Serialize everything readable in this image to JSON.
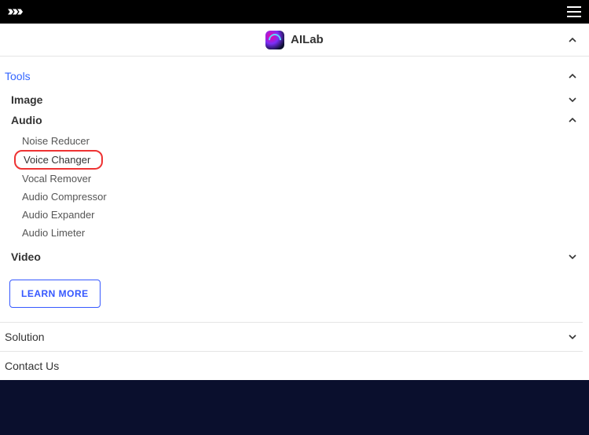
{
  "header": {
    "app_title": "AILab"
  },
  "nav": {
    "tools_label": "Tools",
    "groups": {
      "image": {
        "label": "Image"
      },
      "audio": {
        "label": "Audio",
        "items": [
          "Noise Reducer",
          "Voice Changer",
          "Vocal Remover",
          "Audio Compressor",
          "Audio Expander",
          "Audio Limeter"
        ],
        "active_index": 1
      },
      "video": {
        "label": "Video"
      }
    },
    "learn_more": "LEARN MORE",
    "solution_label": "Solution",
    "contact_label": "Contact Us"
  }
}
